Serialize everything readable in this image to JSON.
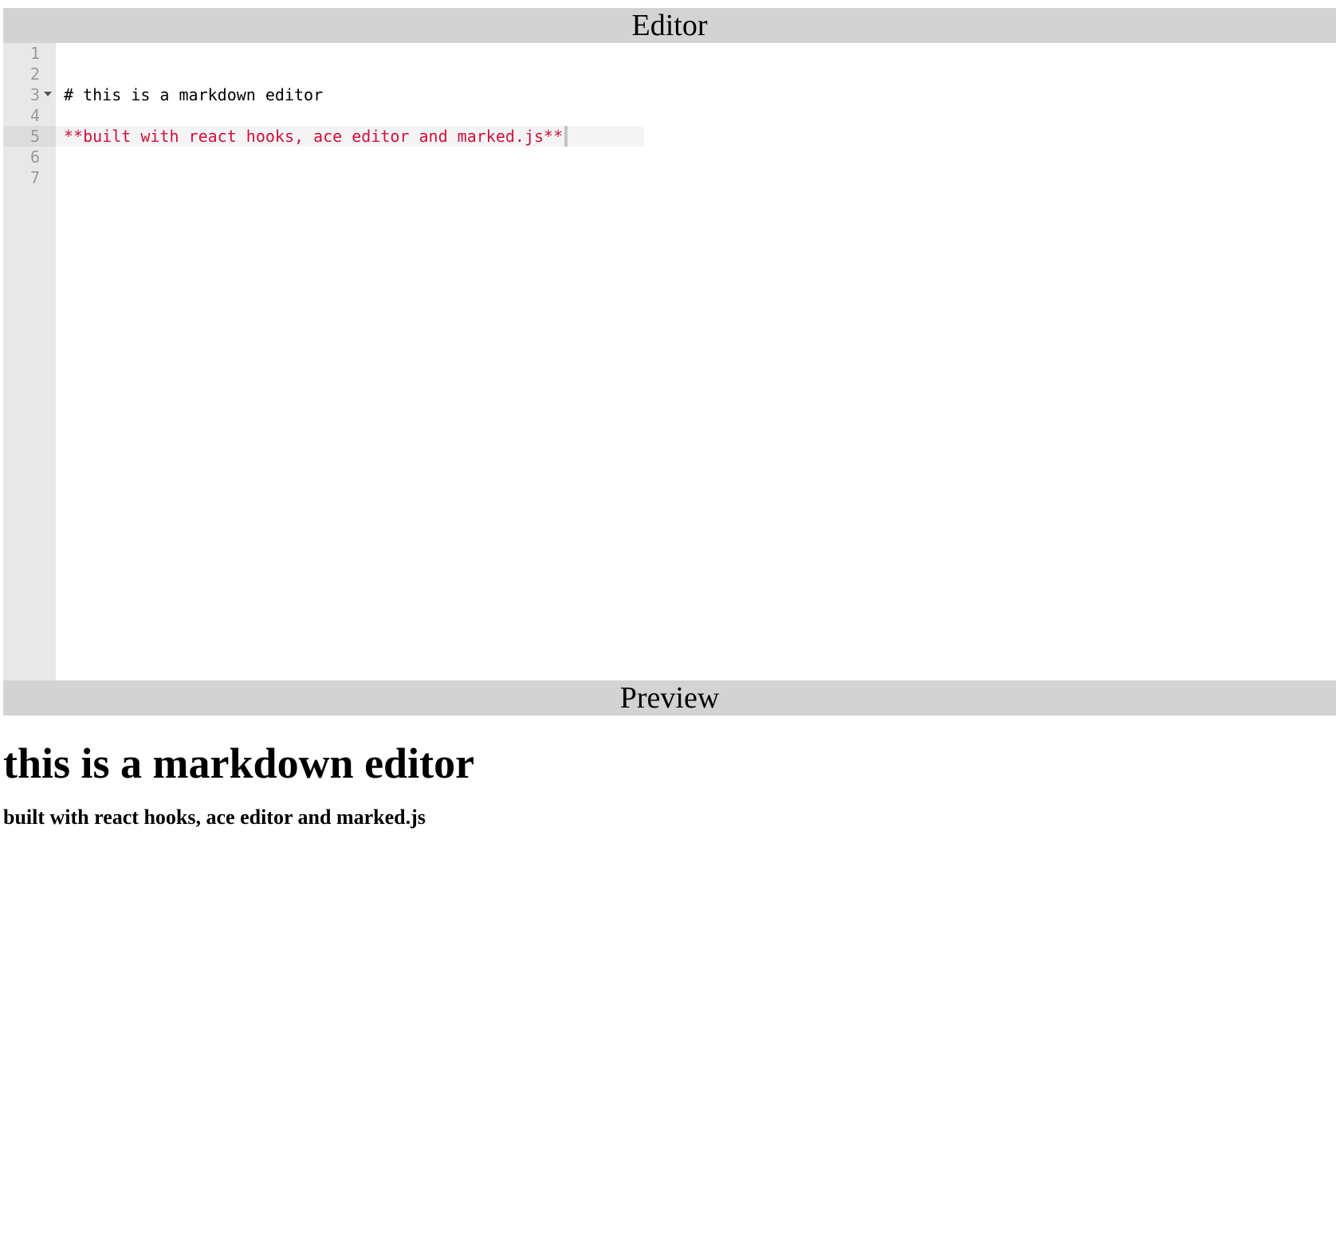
{
  "editor": {
    "header": "Editor",
    "lines": [
      {
        "number": "1",
        "text": ""
      },
      {
        "number": "2",
        "text": ""
      },
      {
        "number": "3",
        "text": "# this is a markdown editor"
      },
      {
        "number": "4",
        "text": ""
      },
      {
        "number": "5",
        "text": "**built with react hooks, ace editor and marked.js**"
      },
      {
        "number": "6",
        "text": ""
      },
      {
        "number": "7",
        "text": ""
      }
    ],
    "active_line": 5,
    "fold_line": 3,
    "colors": {
      "gutter_bg": "#e8e8e8",
      "header_bg": "#d3d3d3",
      "strong_text": "#d0103a",
      "line_number": "#9a9a9a"
    }
  },
  "preview": {
    "header": "Preview",
    "heading": "this is a markdown editor",
    "paragraph": "built with react hooks, ace editor and marked.js"
  }
}
